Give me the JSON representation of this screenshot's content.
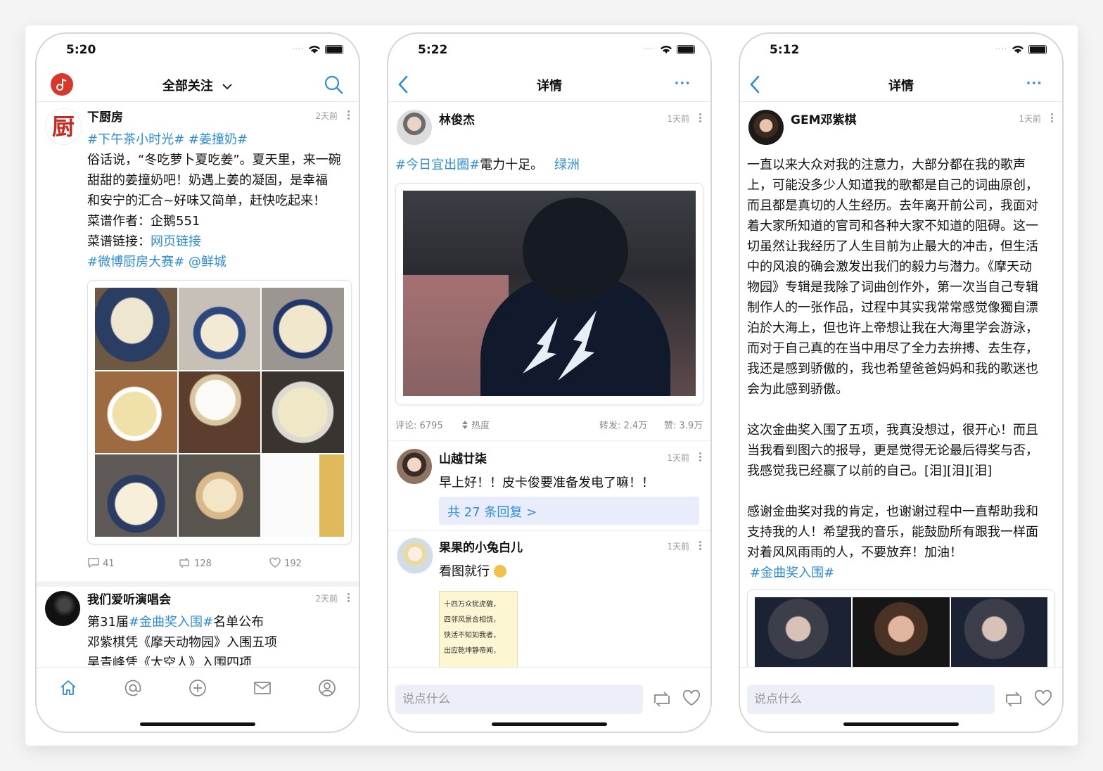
{
  "colors": {
    "accent": "#2e8cd8",
    "text": "#111111",
    "meta": "#999999",
    "reply_bg": "#e9ecfa"
  },
  "phone1": {
    "time": "5:20",
    "nav_title": "全部关注",
    "post1": {
      "author": "下厨房",
      "avatar_char": "厨",
      "time": "2天前",
      "tags": "#下午茶小时光# #姜撞奶#",
      "lines": [
        "俗话说，“冬吃萝卜夏吃姜”。夏天里，来一碗",
        "甜甜的姜撞奶吧！奶遇上姜的凝固，是幸福",
        "和安宁的汇合~好味又简单，赶快吃起来！"
      ],
      "author_line": "菜谱作者：企鹅551",
      "link_label": "菜谱链接：",
      "link_text": "网页链接",
      "footer_tags": "#微博厨房大赛# @鲜城",
      "comments": "41",
      "reposts": "128",
      "likes": "192"
    },
    "post2": {
      "author": "我们爱听演唱会",
      "time": "2天前",
      "line1_pre": "第31届",
      "line1_tag": "#金曲奖入围#",
      "line1_post": "名单公布",
      "line2": "邓紫棋凭《摩天动物园》入围五项",
      "line3": "吴青峰凭《太空人》入围四项"
    },
    "tabs": [
      {
        "icon": "home-icon"
      },
      {
        "icon": "at-icon"
      },
      {
        "icon": "plus-icon"
      },
      {
        "icon": "mail-icon"
      },
      {
        "icon": "profile-icon"
      }
    ]
  },
  "phone2": {
    "time": "5:22",
    "nav_title": "详情",
    "post": {
      "author": "林俊杰",
      "time": "1天前",
      "tag": "#今日宜出圈#",
      "text": "電力十足。",
      "link": "绿洲"
    },
    "stats": {
      "comments": "评论: 6795",
      "sort": "热度",
      "reposts": "转发: 2.4万",
      "likes": "赞: 3.9万"
    },
    "comment1": {
      "author": "山越廿柒",
      "time": "1天前",
      "text": "早上好！！皮卡俊要准备发电了嘛！！",
      "replies": "共 27 条回复 >"
    },
    "comment2": {
      "author": "果果的小兔白儿",
      "time": "1天前",
      "text": "看图就行",
      "poem": [
        "十四万众犹虎貔，",
        "四邻风景合相饶，",
        "快活不知如我者，",
        "出应乾坤静帝闻，"
      ]
    },
    "input_placeholder": "说点什么"
  },
  "phone3": {
    "time": "5:12",
    "nav_title": "详情",
    "post": {
      "author": "GEM邓紫棋",
      "time": "1天前",
      "para1": [
        "一直以来大众对我的注意力，大部分都在我的歌声",
        "上，可能没多少人知道我的歌都是自己的词曲原创，",
        "而且都是真切的人生经历。去年离开前公司，我面对",
        "着大家所知道的官司和各种大家不知道的阻碍。这一",
        "切虽然让我经历了人生目前为止最大的冲击，但生活",
        "中的风浪的确会激发出我们的毅力与潜力。《摩天动",
        "物园》专辑是我除了词曲创作外，第一次当自己专辑",
        "制作人的一张作品，过程中其实我常常感觉像獨自漂",
        "泊於大海上，但也许上帝想让我在大海里学会游泳，",
        "而对于自己真的在当中用尽了全力去拚搏、去生存，",
        "我还是感到骄傲的，我也希望爸爸妈妈和我的歌迷也",
        "会为此感到骄傲。"
      ],
      "para2": [
        "这次金曲奖入围了五项，我真没想过，很开心！而且",
        "当我看到图六的报导，更是觉得无论最后得奖与否，",
        "我感觉我已经赢了以前的自己。[泪][泪][泪]"
      ],
      "para3": [
        "感谢金曲奖对我的肯定，也谢谢过程中一直帮助我和",
        "支持我的人！希望我的音乐，能鼓励所有跟我一样面",
        "对着风风雨雨的人，不要放弃！加油！"
      ],
      "tag": "#金曲奖入围#"
    },
    "input_placeholder": "说点什么"
  }
}
